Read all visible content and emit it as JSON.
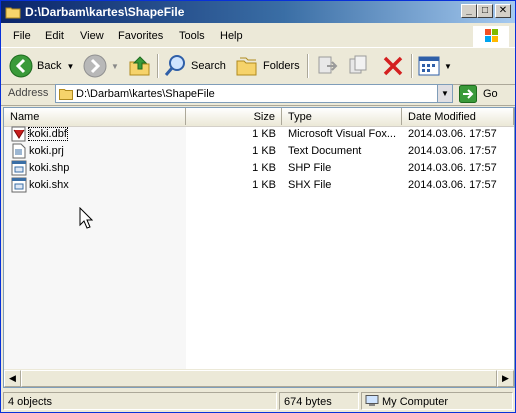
{
  "window": {
    "title": "D:\\Darbam\\kartes\\ShapeFile"
  },
  "title_buttons": {
    "minimize": "_",
    "maximize": "□",
    "close": "✕"
  },
  "menu": [
    "File",
    "Edit",
    "View",
    "Favorites",
    "Tools",
    "Help"
  ],
  "toolbar": {
    "back_label": "Back",
    "search_label": "Search",
    "folders_label": "Folders"
  },
  "address": {
    "label": "Address",
    "path": "D:\\Darbam\\kartes\\ShapeFile",
    "go_label": "Go"
  },
  "columns": [
    "Name",
    "Size",
    "Type",
    "Date Modified"
  ],
  "files": [
    {
      "name": "koki.dbf",
      "size": "1 KB",
      "type": "Microsoft Visual Fox...",
      "modified": "2014.03.06. 17:57",
      "icon": "dbf-file-icon"
    },
    {
      "name": "koki.prj",
      "size": "1 KB",
      "type": "Text Document",
      "modified": "2014.03.06. 17:57",
      "icon": "text-file-icon"
    },
    {
      "name": "koki.shp",
      "size": "1 KB",
      "type": "SHP File",
      "modified": "2014.03.06. 17:57",
      "icon": "generic-file-icon"
    },
    {
      "name": "koki.shx",
      "size": "1 KB",
      "type": "SHX File",
      "modified": "2014.03.06. 17:57",
      "icon": "generic-file-icon"
    }
  ],
  "status": {
    "objects": "4 objects",
    "bytes": "674 bytes",
    "location": "My Computer"
  },
  "colors": {
    "title_active": "#0a246a",
    "go_green": "#3a9a3a",
    "delete_red": "#d42020"
  }
}
